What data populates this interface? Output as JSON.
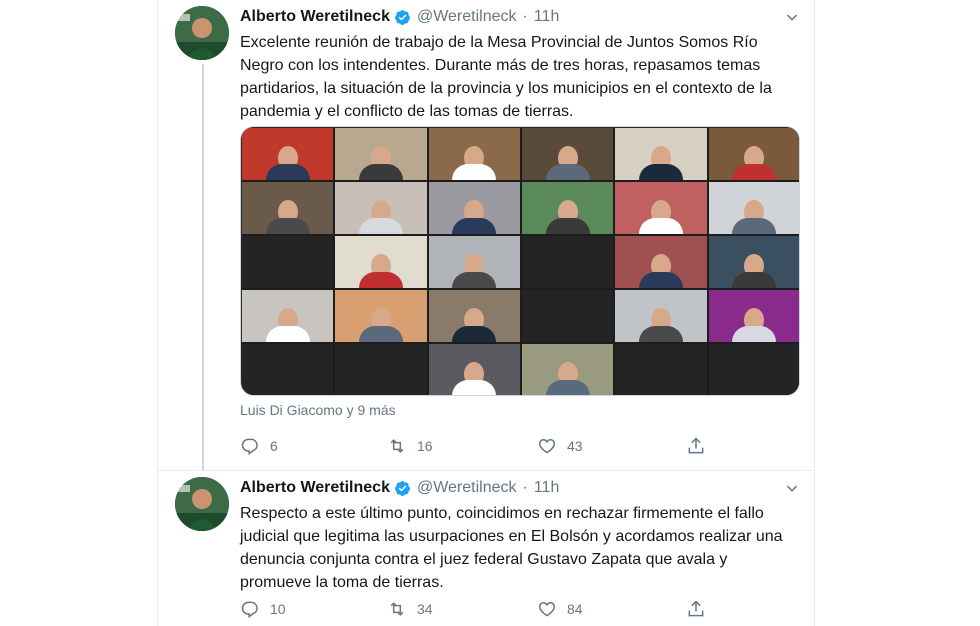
{
  "tweets": [
    {
      "author": "Alberto Weretilneck",
      "handle": "@Weretilneck",
      "time": "11h",
      "text": "Excelente reunión de trabajo de la Mesa Provincial de Juntos Somos Río Negro con los intendentes. Durante más de tres horas, repasamos temas partidarios, la situación de la provincia y los municipios en el contexto de la pandemia y el conflicto de las tomas de tierras.",
      "tagged": "Luis Di Giacomo y 9 más",
      "replies": "6",
      "retweets": "16",
      "likes": "43"
    },
    {
      "author": "Alberto Weretilneck",
      "handle": "@Weretilneck",
      "time": "11h",
      "text": "Respecto a este último punto, coincidimos en rechazar firmemente el fallo judicial que legitima las usurpaciones en El Bolsón y acordamos realizar una denuncia conjunta contra el juez federal Gustavo Zapata que avala y promueve la toma de tierras.",
      "replies": "10",
      "retweets": "34",
      "likes": "84"
    }
  ],
  "icons": {
    "verified": "verified-badge-icon",
    "caret": "chevron-down-icon",
    "reply": "reply-icon",
    "retweet": "retweet-icon",
    "like": "heart-icon",
    "share": "share-icon"
  },
  "colors": {
    "verified": "#1da1f2",
    "secondary_text": "#657786",
    "border": "#e6ecf0",
    "active_speaker": "#d9d13a"
  }
}
